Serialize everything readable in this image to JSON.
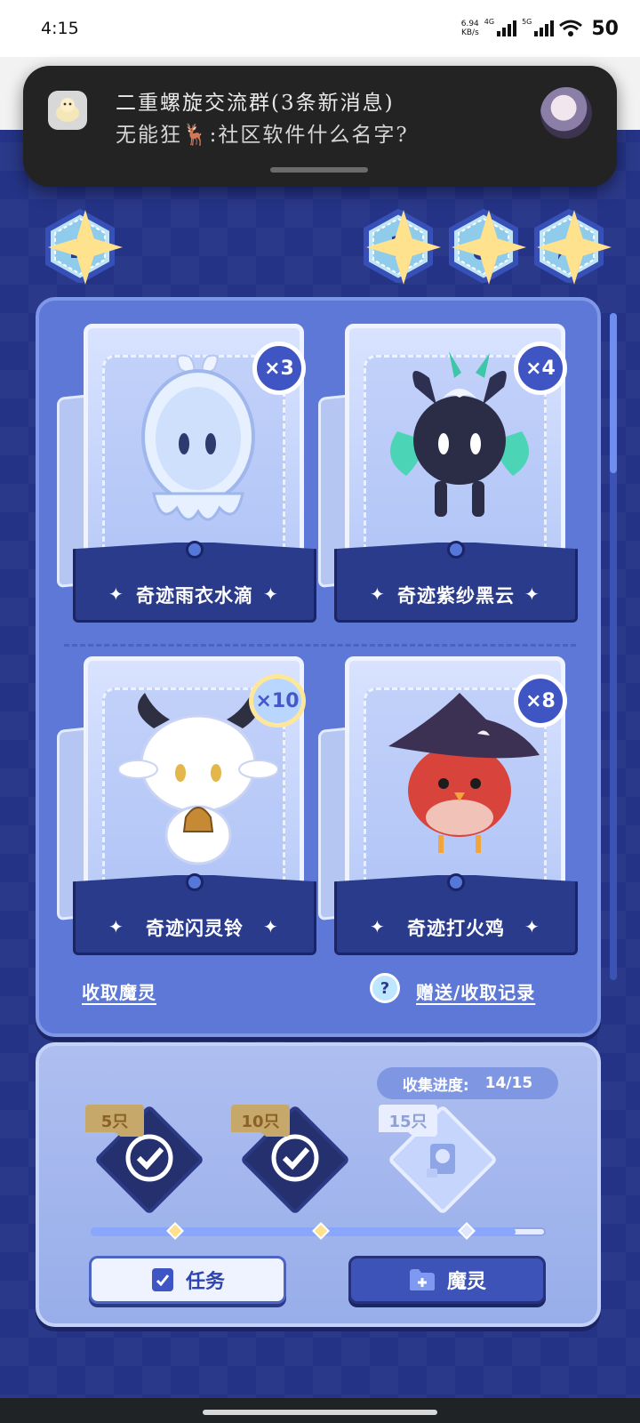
{
  "status_bar": {
    "time": "4:15",
    "net_speed_value": "6.94",
    "net_speed_unit": "KB/s",
    "signal_tag_1": "4G",
    "signal_tag_2": "5G",
    "battery": "50"
  },
  "notification": {
    "title": "二重螺旋交流群(3条新消息)",
    "message": "无能狂🦌:社区软件什么名字?",
    "app_icon": "chat-app-icon",
    "avatar": "sender-avatar"
  },
  "top_buttons": {
    "home": "home-icon",
    "help": "question-icon",
    "music": "music-note-icon",
    "share": "share-arrow-icon"
  },
  "cards": [
    {
      "name": "奇迹雨衣水滴",
      "count": "×3"
    },
    {
      "name": "奇迹紫纱黑云",
      "count": "×4"
    },
    {
      "name": "奇迹闪灵铃",
      "count": "×10"
    },
    {
      "name": "奇迹打火鸡",
      "count": "×8"
    }
  ],
  "panel_links": {
    "receive": "收取魔灵",
    "records": "赠送/收取记录"
  },
  "progress": {
    "label": "收集进度:",
    "value": "14/15",
    "collected": 14,
    "total": 15,
    "milestones": [
      {
        "label": "5只",
        "claimed": true
      },
      {
        "label": "10只",
        "claimed": true
      },
      {
        "label": "15只",
        "claimed": false
      }
    ]
  },
  "bottom_buttons": {
    "task": "任务",
    "spirit": "魔灵"
  },
  "colors": {
    "background": "#243386",
    "panel": "#5d78d6",
    "accent": "#3f55c4",
    "claim_tag": "#c6a86b"
  }
}
